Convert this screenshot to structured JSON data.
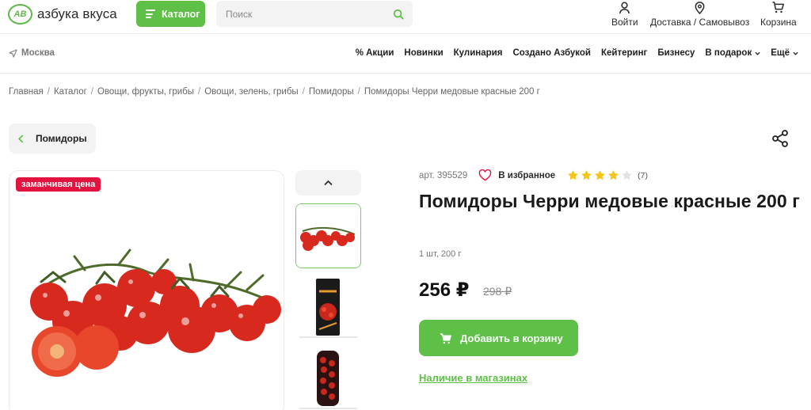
{
  "header": {
    "logo_text": "азбука вкуса",
    "logo_mark": "АВ",
    "catalog_label": "Каталог",
    "search_placeholder": "Поиск",
    "actions": {
      "login": "Войти",
      "delivery": "Доставка / Самовывоз",
      "cart": "Корзина"
    }
  },
  "nav": {
    "city": "Москва",
    "items": [
      "% Акции",
      "Новинки",
      "Кулинария",
      "Создано Азбукой",
      "Кейтеринг",
      "Бизнесу",
      "В подарок",
      "Ещё"
    ]
  },
  "breadcrumbs": [
    "Главная",
    "Каталог",
    "Овощи, фрукты, грибы",
    "Овощи, зелень, грибы",
    "Помидоры",
    "Помидоры Черри медовые красные 200 г"
  ],
  "back_label": "Помидоры",
  "gallery": {
    "promo_badge": "заманчивая цена"
  },
  "product": {
    "article": "арт. 395529",
    "favorite_label": "В избранное",
    "rating": 4,
    "rating_max": 5,
    "reviews": "(7)",
    "title": "Помидоры Черри медовые красные 200 г",
    "pack": "1 шт, 200 г",
    "price": "256 ₽",
    "old_price": "298 ₽",
    "add_to_cart": "Добавить в корзину",
    "stores_link": "Наличие в магазинах"
  },
  "colors": {
    "accent": "#5ec046",
    "promo": "#e2143f",
    "star": "#f5c518"
  }
}
